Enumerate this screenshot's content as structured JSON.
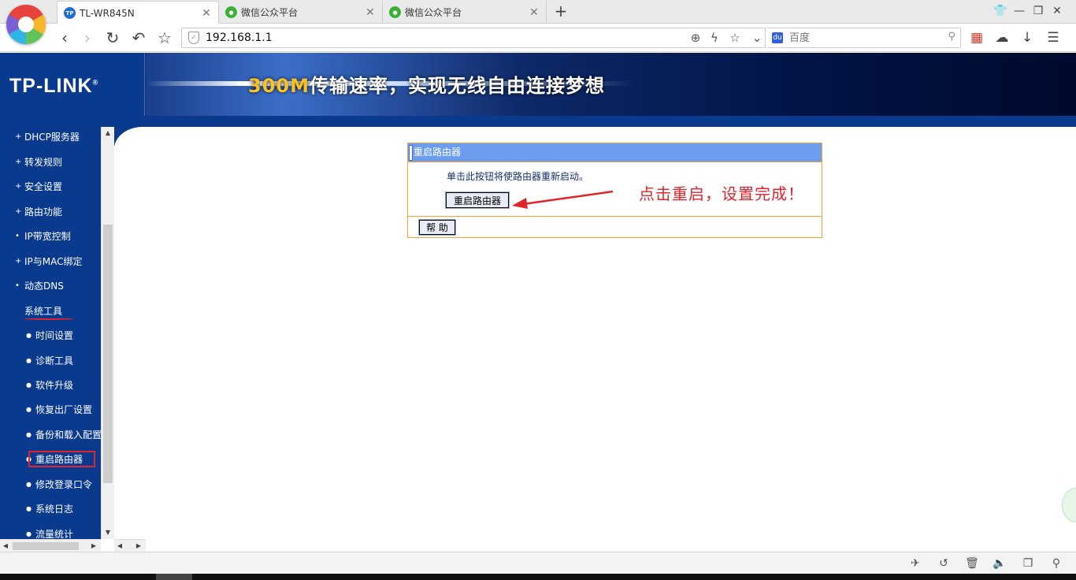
{
  "browser": {
    "tabs": [
      {
        "title": "TL-WR845N",
        "icon": "tp-link-favicon",
        "active": true
      },
      {
        "title": "微信公众平台",
        "icon": "wechat-favicon",
        "active": false
      },
      {
        "title": "微信公众平台",
        "icon": "wechat-favicon",
        "active": false
      }
    ],
    "new_tab": "+",
    "favicon_tp_text": "TP",
    "address": "192.168.1.1",
    "search_placeholder": "百度",
    "search_engine_glyph": "du"
  },
  "banner": {
    "logo": "TP-LINK",
    "logo_mark": "®",
    "slogan_highlight": "300M",
    "slogan_rest": "传输速率，实现无线自由连接梦想"
  },
  "sidebar": {
    "items": [
      {
        "label": "DHCP服务器",
        "level": 1
      },
      {
        "label": "转发规则",
        "level": 1
      },
      {
        "label": "安全设置",
        "level": 1
      },
      {
        "label": "路由功能",
        "level": 1
      },
      {
        "label": "IP带宽控制",
        "level": 1
      },
      {
        "label": "IP与MAC绑定",
        "level": 1
      },
      {
        "label": "动态DNS",
        "level": 1
      },
      {
        "label": "系统工具",
        "level": 1
      },
      {
        "label": "时间设置",
        "level": 2
      },
      {
        "label": "诊断工具",
        "level": 2
      },
      {
        "label": "软件升级",
        "level": 2
      },
      {
        "label": "恢复出厂设置",
        "level": 2
      },
      {
        "label": "备份和载入配置",
        "level": 2
      },
      {
        "label": "重启路由器",
        "level": 2
      },
      {
        "label": "修改登录口令",
        "level": 2
      },
      {
        "label": "系统日志",
        "level": 2
      },
      {
        "label": "流量统计",
        "level": 2
      }
    ]
  },
  "panel": {
    "title": "重启路由器",
    "description": "单击此按钮将使路由器重新启动。",
    "reboot_button": "重启路由器",
    "help_button": "帮 助"
  },
  "annotation": {
    "text": "点击重启，设置完成！",
    "color": "#e0242c"
  },
  "colors": {
    "brand_blue": "#0a3a8e",
    "panel_header": "#6c9cee",
    "panel_border": "#f2a43a",
    "slogan_highlight": "#f6c224"
  }
}
